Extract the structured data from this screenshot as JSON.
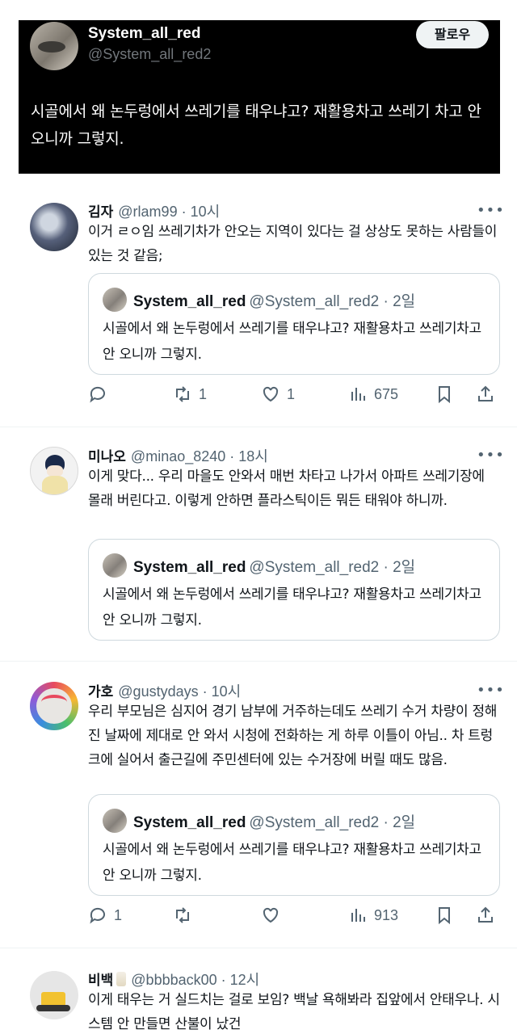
{
  "header": {
    "name": "System_all_red",
    "handle": "@System_all_red2",
    "follow_label": "팔로우",
    "text": "시골에서 왜 논두렁에서 쓰레기를 태우냐고? 재활용차고 쓰레기 차고 안 오니까 그렇지."
  },
  "quote": {
    "name": "System_all_red",
    "handle": "@System_all_red2 · 2일",
    "text": "시골에서 왜 논두렁에서 쓰레기를 태우냐고? 재활용차고 쓰레기차고 안 오니까 그렇지."
  },
  "replies": [
    {
      "name": "김자",
      "handle": "@rlam99 · 10시",
      "text": "이거 ㄹㅇ임 쓰레기차가 안오는 지역이 있다는 걸 상상도 못하는 사람들이 있는 것 같음;",
      "retweets": "1",
      "likes": "1",
      "views": "675"
    },
    {
      "name": "미나오",
      "handle": "@minao_8240 · 18시",
      "text": "이게 맞다... 우리 마을도 안와서 매번 차타고 나가서 아파트 쓰레기장에 몰래 버린다고. 이렇게 안하면 플라스틱이든 뭐든 태워야 하니까."
    },
    {
      "name": "가호",
      "handle": "@gustydays · 10시",
      "text": "우리 부모님은 심지어 경기 남부에 거주하는데도 쓰레기 수거 차량이 정해진 날짜에 제대로 안 와서 시청에 전화하는 게 하루 이틀이 아님.. 차 트렁크에 실어서 출근길에 주민센터에 있는 수거장에 버릴 때도 많음.",
      "replies_count": "1",
      "views": "913"
    },
    {
      "name": "비백",
      "handle": "@bbbback00 · 12시",
      "text": "이게 태우는 거 실드치는 걸로 보임? 백날 욕해봐라 집앞에서 안태우나. 시스템 안 만들면 산불이 났건"
    }
  ],
  "icons": {
    "more": "more-icon",
    "reply": "reply-icon",
    "retweet": "retweet-icon",
    "like": "heart-icon",
    "views": "views-icon",
    "bookmark": "bookmark-icon",
    "share": "share-icon"
  },
  "colors": {
    "header_bg": "#000000",
    "secondary_text": "#536471",
    "border": "#cfd9de"
  }
}
